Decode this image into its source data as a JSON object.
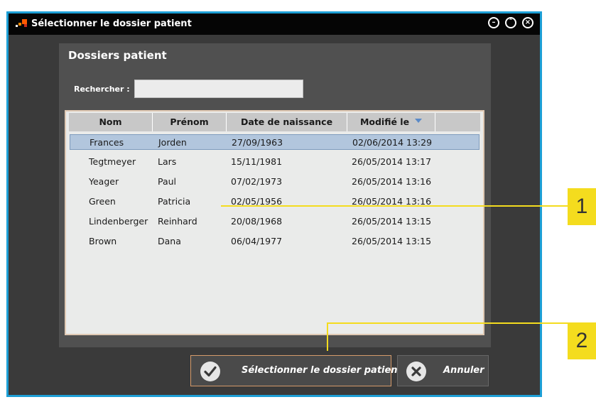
{
  "window": {
    "title": "Sélectionner le dossier patient",
    "accent_color": "#1d9fd6",
    "controls": [
      "minimize-icon",
      "maximize-icon",
      "close-icon"
    ]
  },
  "panel": {
    "title": "Dossiers patient",
    "search": {
      "label": "Rechercher :",
      "value": "",
      "placeholder": ""
    }
  },
  "table": {
    "columns": [
      "Nom",
      "Prénom",
      "Date de naissance",
      "Modifié le"
    ],
    "sorted_column": "Modifié le",
    "sort_direction": "descending",
    "selected_row": 0,
    "rows": [
      [
        "Frances",
        "Jorden",
        "27/09/1963",
        "02/06/2014 13:29"
      ],
      [
        "Tegtmeyer",
        "Lars",
        "15/11/1981",
        "26/05/2014 13:17"
      ],
      [
        "Yeager",
        "Paul",
        "07/02/1973",
        "26/05/2014 13:16"
      ],
      [
        "Green",
        "Patricia",
        "02/05/1956",
        "26/05/2014 13:16"
      ],
      [
        "Lindenberger",
        "Reinhard",
        "20/08/1968",
        "26/05/2014 13:15"
      ],
      [
        "Brown",
        "Dana",
        "06/04/1977",
        "26/05/2014 13:15"
      ]
    ]
  },
  "buttons": {
    "select_label": "Sélectionner le dossier patient",
    "select_icon": "checkmark-icon",
    "cancel_label": "Annuler",
    "cancel_icon": "cancel-x-icon"
  },
  "callouts": [
    {
      "number": "1",
      "target": "patient-table"
    },
    {
      "number": "2",
      "target": "select-patient-button"
    }
  ],
  "colors": {
    "callout": "#f4dc1e",
    "selected_row": "#b2c6dd"
  }
}
